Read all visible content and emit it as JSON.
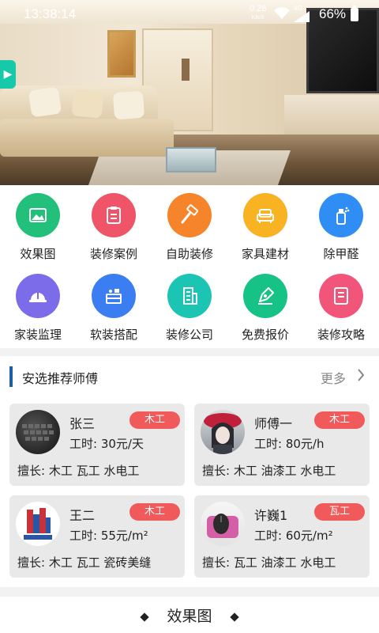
{
  "status_bar": {
    "time": "13:38:14",
    "net_speed": "0.28",
    "net_unit": "KB/S",
    "network": "4G",
    "battery": "66%"
  },
  "categories": [
    {
      "label": "效果图",
      "icon": "image-icon",
      "color": "#22c07a"
    },
    {
      "label": "装修案例",
      "icon": "clipboard-icon",
      "color": "#f05468"
    },
    {
      "label": "自助装修",
      "icon": "hammer-icon",
      "color": "#f5842a"
    },
    {
      "label": "家具建材",
      "icon": "sofa-icon",
      "color": "#f7b322"
    },
    {
      "label": "除甲醛",
      "icon": "spray-icon",
      "color": "#2f8ef4"
    },
    {
      "label": "家装监理",
      "icon": "helmet-icon",
      "color": "#7d6ce9"
    },
    {
      "label": "软装搭配",
      "icon": "furniture-icon",
      "color": "#3b7ef2"
    },
    {
      "label": "装修公司",
      "icon": "building-icon",
      "color": "#1cc4b4"
    },
    {
      "label": "免费报价",
      "icon": "pen-icon",
      "color": "#17c286"
    },
    {
      "label": "装修攻略",
      "icon": "book-icon",
      "color": "#f1557a"
    }
  ],
  "section": {
    "title": "安选推荐师傅",
    "more": "更多"
  },
  "workers": [
    {
      "name": "张三",
      "trade": "木工",
      "wage": "工时: 30元/天",
      "skills": "擅长: 木工 瓦工 水电工",
      "avatar": "keyboard-photo"
    },
    {
      "name": "师傅一",
      "trade": "木工",
      "wage": "工时: 80元/h",
      "skills": "擅长: 木工 油漆工 水电工",
      "avatar": "anime-girl-photo"
    },
    {
      "name": "王二",
      "trade": "木工",
      "wage": "工时: 55元/m²",
      "skills": "擅长: 木工 瓦工 瓷砖美缝",
      "avatar": "building-logo"
    },
    {
      "name": "许巍1",
      "trade": "瓦工",
      "wage": "工时: 60元/m²",
      "skills": "擅长: 瓦工 油漆工 水电工",
      "avatar": "mouse-photo"
    }
  ],
  "footer": {
    "title": "效果图"
  },
  "colors": {
    "accent_bar": "#1f5fa8",
    "badge": "#f05a5a",
    "side_tab": "#16c9a8"
  }
}
